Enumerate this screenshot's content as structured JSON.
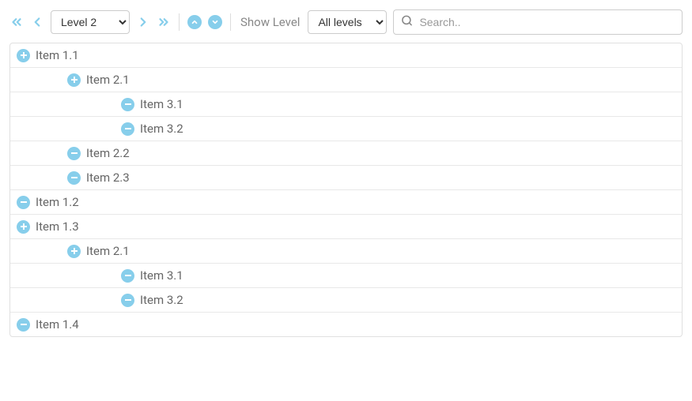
{
  "toolbar": {
    "level_select_value": "Level 2",
    "show_level_label": "Show Level",
    "all_levels_value": "All levels",
    "search_placeholder": "Search.."
  },
  "tree": [
    {
      "label": "Item 1.1",
      "indent": 0,
      "icon": "plus"
    },
    {
      "label": "Item 2.1",
      "indent": 1,
      "icon": "plus"
    },
    {
      "label": "Item 3.1",
      "indent": 2,
      "icon": "minus"
    },
    {
      "label": "Item 3.2",
      "indent": 2,
      "icon": "minus"
    },
    {
      "label": "Item 2.2",
      "indent": 1,
      "icon": "minus"
    },
    {
      "label": "Item 2.3",
      "indent": 1,
      "icon": "minus"
    },
    {
      "label": "Item 1.2",
      "indent": 0,
      "icon": "minus"
    },
    {
      "label": "Item 1.3",
      "indent": 0,
      "icon": "plus"
    },
    {
      "label": "Item 2.1",
      "indent": 1,
      "icon": "plus"
    },
    {
      "label": "Item 3.1",
      "indent": 2,
      "icon": "minus"
    },
    {
      "label": "Item 3.2",
      "indent": 2,
      "icon": "minus"
    },
    {
      "label": "Item 1.4",
      "indent": 0,
      "icon": "minus"
    }
  ]
}
